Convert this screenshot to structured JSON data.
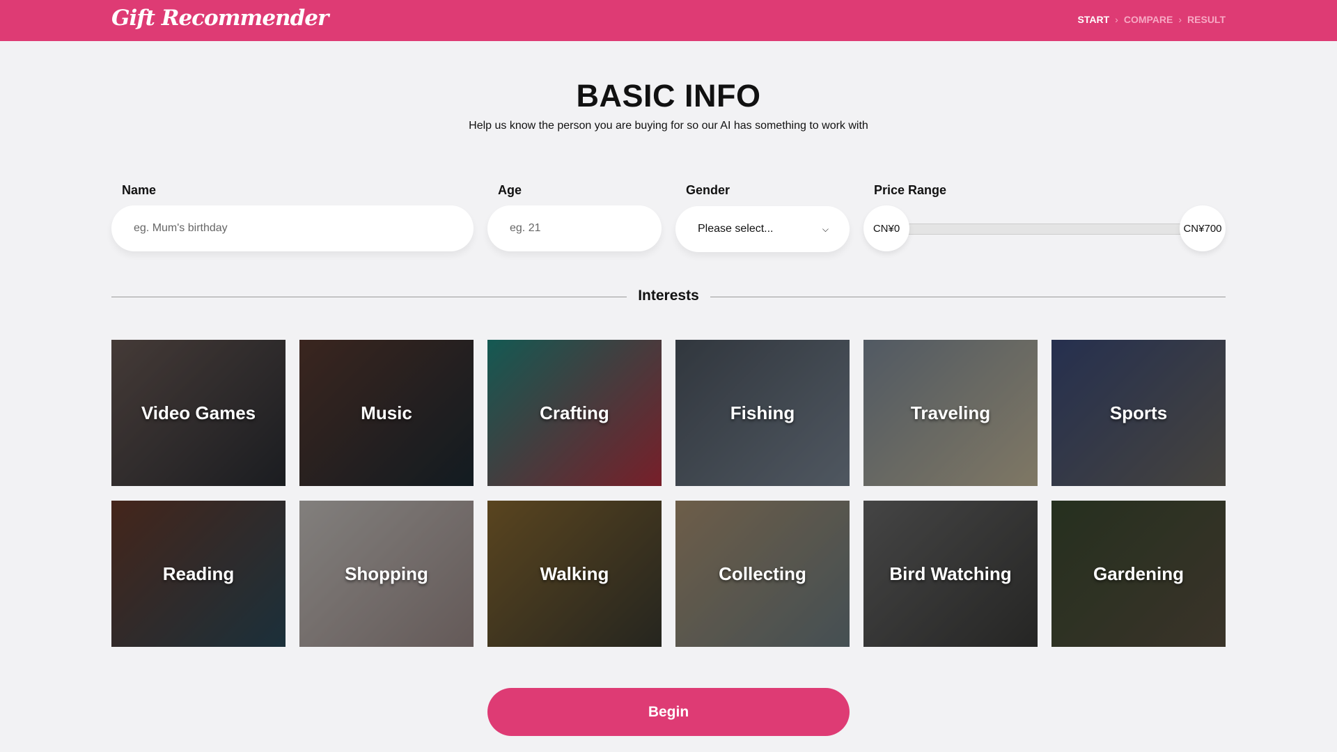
{
  "header": {
    "logo": "Gift Recommender",
    "breadcrumb": [
      "START",
      "COMPARE",
      "RESULT"
    ],
    "brand_color": "#de3b74"
  },
  "page": {
    "title": "BASIC INFO",
    "subtitle": "Help us know the person you are buying for so our AI has something to work with"
  },
  "form": {
    "name": {
      "label": "Name",
      "placeholder": "eg. Mum's birthday",
      "value": ""
    },
    "age": {
      "label": "Age",
      "placeholder": "eg. 21",
      "value": ""
    },
    "gender": {
      "label": "Gender",
      "selected": "Please select..."
    },
    "price": {
      "label": "Price Range",
      "min_label": "CN¥0",
      "max_label": "CN¥700",
      "min": 0,
      "max": 700
    }
  },
  "interests": {
    "heading": "Interests",
    "items": [
      {
        "label": "Video Games",
        "colors": [
          "#6a5a55",
          "#2a2d33"
        ]
      },
      {
        "label": "Music",
        "colors": [
          "#5a3a30",
          "#1d2a33"
        ]
      },
      {
        "label": "Crafting",
        "colors": [
          "#1f8a80",
          "#b83040"
        ]
      },
      {
        "label": "Fishing",
        "colors": [
          "#4c5560",
          "#7a8694"
        ]
      },
      {
        "label": "Traveling",
        "colors": [
          "#7d8a98",
          "#c4b89a"
        ]
      },
      {
        "label": "Sports",
        "colors": [
          "#3a4a7a",
          "#6c6860"
        ]
      },
      {
        "label": "Reading",
        "colors": [
          "#6a3a2a",
          "#2a4a5a"
        ]
      },
      {
        "label": "Shopping",
        "colors": [
          "#c8c4c0",
          "#9a8a88"
        ]
      },
      {
        "label": "Walking",
        "colors": [
          "#8a6a30",
          "#3a3a30"
        ]
      },
      {
        "label": "Collecting",
        "colors": [
          "#a89070",
          "#6a7a80"
        ]
      },
      {
        "label": "Bird Watching",
        "colors": [
          "#6a6a6a",
          "#3a3a38"
        ]
      },
      {
        "label": "Gardening",
        "colors": [
          "#3a4a30",
          "#5a5040"
        ]
      }
    ]
  },
  "actions": {
    "begin": "Begin"
  }
}
